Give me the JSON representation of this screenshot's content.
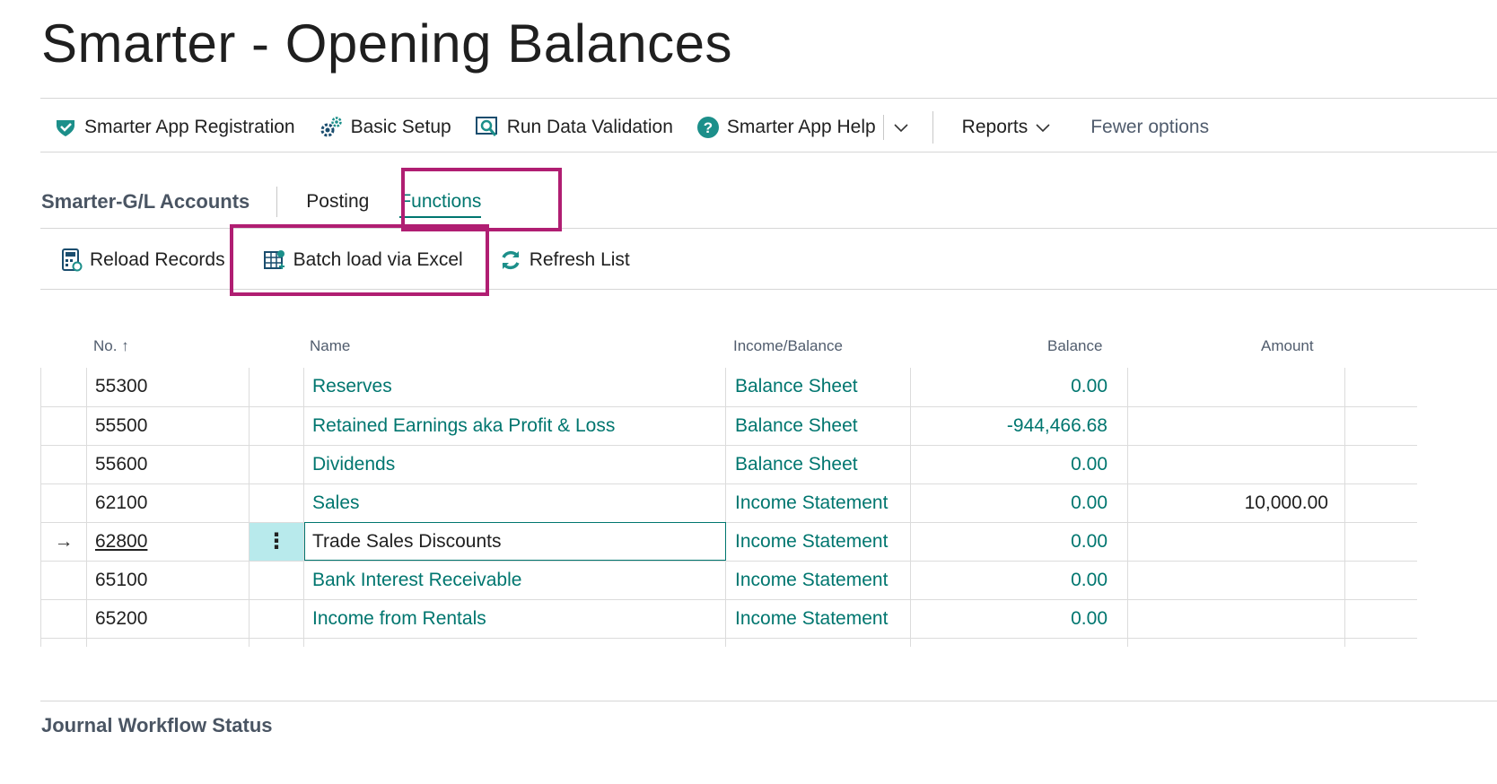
{
  "page": {
    "title": "Smarter - Opening Balances"
  },
  "action_bar": {
    "items": [
      {
        "label": "Smarter App Registration",
        "icon": "registration-icon"
      },
      {
        "label": "Basic Setup",
        "icon": "setup-gears-icon"
      },
      {
        "label": "Run Data Validation",
        "icon": "validation-icon"
      },
      {
        "label": "Smarter App Help",
        "icon": "help-icon"
      }
    ],
    "reports_label": "Reports",
    "fewer_options_label": "Fewer options"
  },
  "tabs": {
    "heading": "Smarter-G/L Accounts",
    "items": [
      {
        "label": "Posting"
      },
      {
        "label": "Functions"
      }
    ]
  },
  "functions": {
    "items": [
      {
        "label": "Reload Records",
        "icon": "calculator-icon"
      },
      {
        "label": "Batch load via Excel",
        "icon": "excel-batch-icon"
      },
      {
        "label": "Refresh List",
        "icon": "refresh-icon"
      }
    ]
  },
  "grid": {
    "columns": {
      "no": "No.",
      "name": "Name",
      "income_balance": "Income/Balance",
      "balance": "Balance",
      "amount": "Amount"
    },
    "rows": [
      {
        "no": "55300",
        "name": "Reserves",
        "income_balance": "Balance Sheet",
        "balance": "0.00",
        "amount": ""
      },
      {
        "no": "55500",
        "name": "Retained Earnings aka Profit & Loss",
        "income_balance": "Balance Sheet",
        "balance": "-944,466.68",
        "amount": ""
      },
      {
        "no": "55600",
        "name": "Dividends",
        "income_balance": "Balance Sheet",
        "balance": "0.00",
        "amount": ""
      },
      {
        "no": "62100",
        "name": "Sales",
        "income_balance": "Income Statement",
        "balance": "0.00",
        "amount": "10,000.00"
      },
      {
        "no": "62800",
        "name": "Trade Sales  Discounts",
        "income_balance": "Income Statement",
        "balance": "0.00",
        "amount": ""
      },
      {
        "no": "65100",
        "name": "Bank Interest Receivable",
        "income_balance": "Income Statement",
        "balance": "0.00",
        "amount": ""
      },
      {
        "no": "65200",
        "name": "Income from Rentals",
        "income_balance": "Income Statement",
        "balance": "0.00",
        "amount": ""
      }
    ],
    "current_row_marker": "→",
    "row_menu_glyph": "⋮"
  },
  "sections": {
    "journal_workflow_status": "Journal Workflow Status"
  },
  "colors": {
    "accent": "#00766f",
    "highlight_box": "#b01e72",
    "selected_cell": "#b8eaec"
  }
}
